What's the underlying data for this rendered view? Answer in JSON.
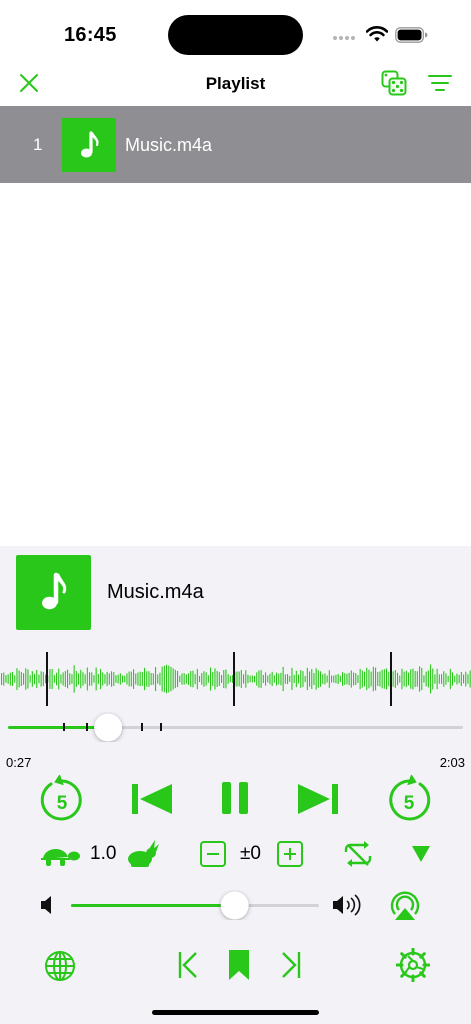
{
  "status_bar": {
    "time": "16:45"
  },
  "nav": {
    "title": "Playlist",
    "close_icon": "close-icon",
    "shuffle_icon": "dice-icon",
    "sort_icon": "sort-lines-icon"
  },
  "playlist": {
    "items": [
      {
        "index": "1",
        "title": "Music.m4a",
        "icon": "music-note-icon",
        "selected": true
      }
    ]
  },
  "player": {
    "title": "Music.m4a",
    "elapsed": "0:27",
    "total": "2:03",
    "progress_fraction": 0.22,
    "speed": "1.0",
    "pitch": "±0",
    "volume_fraction": 0.66,
    "skip_back_seconds": "5",
    "skip_forward_seconds": "5"
  },
  "colors": {
    "accent": "#2ac71b",
    "selected_row": "#8e8e93",
    "player_bg": "#f2f2f7"
  }
}
